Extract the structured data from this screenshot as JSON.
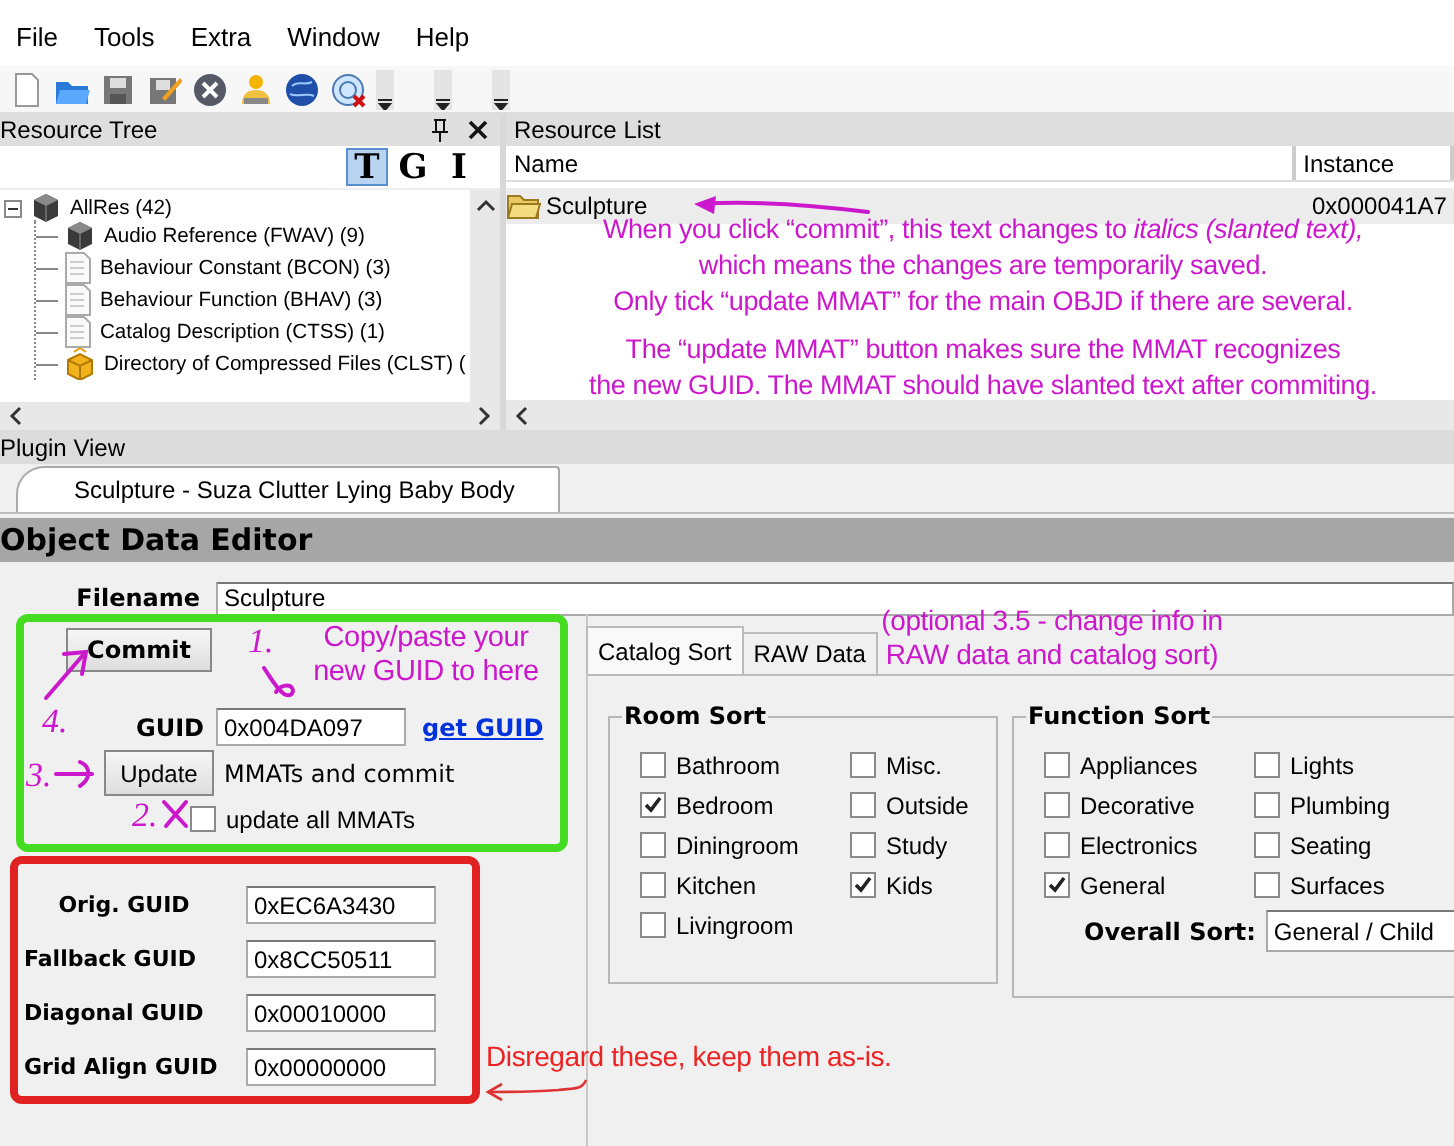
{
  "menu": [
    "File",
    "Tools",
    "Extra",
    "Window",
    "Help"
  ],
  "resource_tree": {
    "title": "Resource Tree",
    "view_buttons": [
      {
        "label": "T",
        "selected": true
      },
      {
        "label": "G",
        "selected": false
      },
      {
        "label": "I",
        "selected": false
      }
    ],
    "items": [
      {
        "label": "AllRes (42)",
        "kind": "cube",
        "expanded": true,
        "children": [
          {
            "label": "Audio Reference (FWAV) (9)",
            "kind": "cube"
          },
          {
            "label": "Behaviour Constant (BCON) (3)",
            "kind": "document"
          },
          {
            "label": "Behaviour Function (BHAV) (3)",
            "kind": "document"
          },
          {
            "label": "Catalog Description (CTSS) (1)",
            "kind": "document"
          },
          {
            "label": "Directory of Compressed Files (CLST) (",
            "kind": "package"
          }
        ]
      }
    ]
  },
  "resource_list": {
    "title": "Resource List",
    "columns": [
      "Name",
      "Instance"
    ],
    "rows": [
      {
        "name": "Sculpture",
        "instance": "0x000041A7"
      }
    ]
  },
  "plugin_view": {
    "title": "Plugin View",
    "tabs": [
      {
        "label": "Sculpture - Suza Clutter Lying Baby Body",
        "selected": true
      }
    ],
    "editor": {
      "title": "Object Data Editor",
      "filename": {
        "label": "Filename",
        "value": "Sculpture"
      },
      "commit_button": "Commit",
      "guid": {
        "label": "GUID",
        "value": "0x004DA097"
      },
      "get_guid_link": "get GUID",
      "update_button": "Update",
      "update_note": "MMATs and commit",
      "update_all": {
        "label": "update all MMATs",
        "checked": false
      },
      "guid_fields": [
        {
          "label": "Orig. GUID",
          "value": "0xEC6A3430"
        },
        {
          "label": "Fallback GUID",
          "value": "0x8CC50511"
        },
        {
          "label": "Diagonal GUID",
          "value": "0x00010000"
        },
        {
          "label": "Grid Align GUID",
          "value": "0x00000000"
        }
      ],
      "tabs": [
        {
          "label": "Catalog Sort",
          "selected": true
        },
        {
          "label": "RAW Data",
          "selected": false
        }
      ],
      "room_sort": {
        "title": "Room Sort",
        "options": [
          {
            "label": "Bathroom",
            "checked": false
          },
          {
            "label": "Bedroom",
            "checked": true
          },
          {
            "label": "Diningroom",
            "checked": false
          },
          {
            "label": "Kitchen",
            "checked": false
          },
          {
            "label": "Livingroom",
            "checked": false
          },
          {
            "label": "Misc.",
            "checked": false
          },
          {
            "label": "Outside",
            "checked": false
          },
          {
            "label": "Study",
            "checked": false
          },
          {
            "label": "Kids",
            "checked": true
          }
        ]
      },
      "function_sort": {
        "title": "Function Sort",
        "options": [
          {
            "label": "Appliances",
            "checked": false
          },
          {
            "label": "Decorative",
            "checked": false
          },
          {
            "label": "Electronics",
            "checked": false
          },
          {
            "label": "General",
            "checked": true
          },
          {
            "label": "Lights",
            "checked": false
          },
          {
            "label": "Plumbing",
            "checked": false
          },
          {
            "label": "Seating",
            "checked": false
          },
          {
            "label": "Surfaces",
            "checked": false
          }
        ],
        "overall_sort": {
          "label": "Overall Sort:",
          "value": "General / Child"
        }
      }
    }
  },
  "annotations": {
    "resource_note": [
      "When you click “commit”, this text changes to *italics (slanted text),*",
      "which means the changes are temporarily saved.",
      "Only tick “update MMAT” for the main OBJD if there are several."
    ],
    "mmat_note": [
      "The “update MMAT” button makes sure the MMAT recognizes",
      "the new GUID. The MMAT should have slanted text after commiting."
    ],
    "catalog_note": "(optional 3.5 - change info in RAW data and catalog sort)",
    "guid_note": "Copy/paste your new GUID to here",
    "steps": [
      "1.",
      "2.",
      "3.",
      "4."
    ],
    "guid_fields_note": "Disregard these, keep them as-is."
  }
}
